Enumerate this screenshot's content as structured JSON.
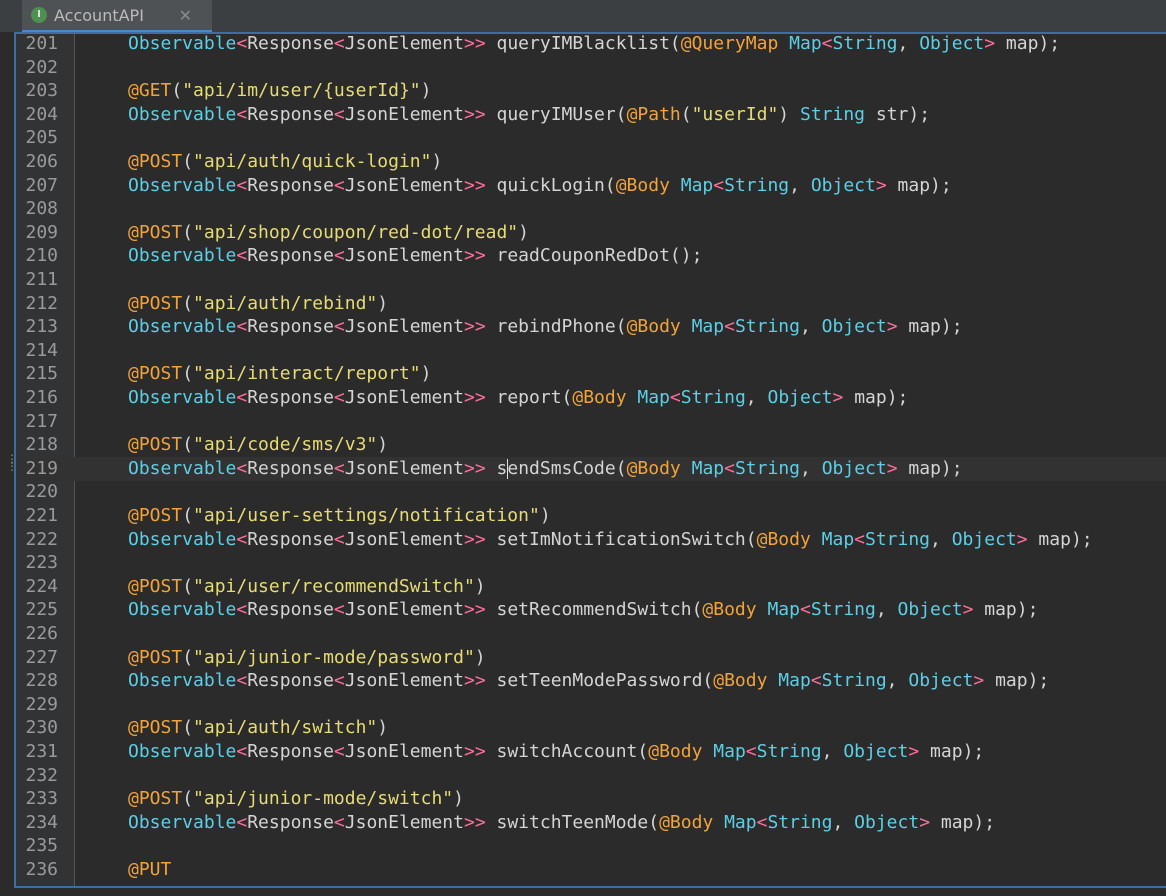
{
  "tab": {
    "title": "AccountAPI",
    "icon": "interface-icon",
    "icon_letter": "I",
    "close": "✕"
  },
  "colors": {
    "background": "#2b2b2b",
    "type": "#5ccfe6",
    "annotation": "#f2a33a",
    "string": "#e6db74",
    "generic_bracket": "#ff6e9b",
    "text": "#d4d4d4",
    "line_number": "#9a9a9a"
  },
  "current_line": 219,
  "lines": [
    {
      "num": 201,
      "tokens": [
        [
          "type",
          "Observable"
        ],
        [
          "angle",
          "<"
        ],
        [
          "plain",
          "Response"
        ],
        [
          "angle",
          "<"
        ],
        [
          "plain",
          "JsonElement"
        ],
        [
          "angle",
          ">>"
        ],
        [
          "plain",
          " queryIMBlacklist("
        ],
        [
          "ann",
          "@QueryMap"
        ],
        [
          "plain",
          " "
        ],
        [
          "type",
          "Map"
        ],
        [
          "angle",
          "<"
        ],
        [
          "type",
          "String"
        ],
        [
          "plain",
          ", "
        ],
        [
          "type",
          "Object"
        ],
        [
          "angle",
          ">"
        ],
        [
          "plain",
          " map);"
        ]
      ]
    },
    {
      "num": 202,
      "tokens": []
    },
    {
      "num": 203,
      "tokens": [
        [
          "ann",
          "@GET"
        ],
        [
          "plain",
          "("
        ],
        [
          "str",
          "\"api/im/user/{userId}\""
        ],
        [
          "plain",
          ")"
        ]
      ]
    },
    {
      "num": 204,
      "tokens": [
        [
          "type",
          "Observable"
        ],
        [
          "angle",
          "<"
        ],
        [
          "plain",
          "Response"
        ],
        [
          "angle",
          "<"
        ],
        [
          "plain",
          "JsonElement"
        ],
        [
          "angle",
          ">>"
        ],
        [
          "plain",
          " queryIMUser("
        ],
        [
          "ann",
          "@Path"
        ],
        [
          "plain",
          "("
        ],
        [
          "str",
          "\"userId\""
        ],
        [
          "plain",
          ") "
        ],
        [
          "type",
          "String"
        ],
        [
          "plain",
          " str);"
        ]
      ]
    },
    {
      "num": 205,
      "tokens": []
    },
    {
      "num": 206,
      "tokens": [
        [
          "ann",
          "@POST"
        ],
        [
          "plain",
          "("
        ],
        [
          "str",
          "\"api/auth/quick-login\""
        ],
        [
          "plain",
          ")"
        ]
      ]
    },
    {
      "num": 207,
      "tokens": [
        [
          "type",
          "Observable"
        ],
        [
          "angle",
          "<"
        ],
        [
          "plain",
          "Response"
        ],
        [
          "angle",
          "<"
        ],
        [
          "plain",
          "JsonElement"
        ],
        [
          "angle",
          ">>"
        ],
        [
          "plain",
          " quickLogin("
        ],
        [
          "ann",
          "@Body"
        ],
        [
          "plain",
          " "
        ],
        [
          "type",
          "Map"
        ],
        [
          "angle",
          "<"
        ],
        [
          "type",
          "String"
        ],
        [
          "plain",
          ", "
        ],
        [
          "type",
          "Object"
        ],
        [
          "angle",
          ">"
        ],
        [
          "plain",
          " map);"
        ]
      ]
    },
    {
      "num": 208,
      "tokens": []
    },
    {
      "num": 209,
      "tokens": [
        [
          "ann",
          "@POST"
        ],
        [
          "plain",
          "("
        ],
        [
          "str",
          "\"api/shop/coupon/red-dot/read\""
        ],
        [
          "plain",
          ")"
        ]
      ]
    },
    {
      "num": 210,
      "tokens": [
        [
          "type",
          "Observable"
        ],
        [
          "angle",
          "<"
        ],
        [
          "plain",
          "Response"
        ],
        [
          "angle",
          "<"
        ],
        [
          "plain",
          "JsonElement"
        ],
        [
          "angle",
          ">>"
        ],
        [
          "plain",
          " readCouponRedDot();"
        ]
      ]
    },
    {
      "num": 211,
      "tokens": []
    },
    {
      "num": 212,
      "tokens": [
        [
          "ann",
          "@POST"
        ],
        [
          "plain",
          "("
        ],
        [
          "str",
          "\"api/auth/rebind\""
        ],
        [
          "plain",
          ")"
        ]
      ]
    },
    {
      "num": 213,
      "tokens": [
        [
          "type",
          "Observable"
        ],
        [
          "angle",
          "<"
        ],
        [
          "plain",
          "Response"
        ],
        [
          "angle",
          "<"
        ],
        [
          "plain",
          "JsonElement"
        ],
        [
          "angle",
          ">>"
        ],
        [
          "plain",
          " rebindPhone("
        ],
        [
          "ann",
          "@Body"
        ],
        [
          "plain",
          " "
        ],
        [
          "type",
          "Map"
        ],
        [
          "angle",
          "<"
        ],
        [
          "type",
          "String"
        ],
        [
          "plain",
          ", "
        ],
        [
          "type",
          "Object"
        ],
        [
          "angle",
          ">"
        ],
        [
          "plain",
          " map);"
        ]
      ]
    },
    {
      "num": 214,
      "tokens": []
    },
    {
      "num": 215,
      "tokens": [
        [
          "ann",
          "@POST"
        ],
        [
          "plain",
          "("
        ],
        [
          "str",
          "\"api/interact/report\""
        ],
        [
          "plain",
          ")"
        ]
      ]
    },
    {
      "num": 216,
      "tokens": [
        [
          "type",
          "Observable"
        ],
        [
          "angle",
          "<"
        ],
        [
          "plain",
          "Response"
        ],
        [
          "angle",
          "<"
        ],
        [
          "plain",
          "JsonElement"
        ],
        [
          "angle",
          ">>"
        ],
        [
          "plain",
          " report("
        ],
        [
          "ann",
          "@Body"
        ],
        [
          "plain",
          " "
        ],
        [
          "type",
          "Map"
        ],
        [
          "angle",
          "<"
        ],
        [
          "type",
          "String"
        ],
        [
          "plain",
          ", "
        ],
        [
          "type",
          "Object"
        ],
        [
          "angle",
          ">"
        ],
        [
          "plain",
          " map);"
        ]
      ]
    },
    {
      "num": 217,
      "tokens": []
    },
    {
      "num": 218,
      "tokens": [
        [
          "ann",
          "@POST"
        ],
        [
          "plain",
          "("
        ],
        [
          "str",
          "\"api/code/sms/v3\""
        ],
        [
          "plain",
          ")"
        ]
      ]
    },
    {
      "num": 219,
      "tokens": [
        [
          "type",
          "Observable"
        ],
        [
          "angle",
          "<"
        ],
        [
          "plain",
          "Response"
        ],
        [
          "angle",
          "<"
        ],
        [
          "plain",
          "JsonElement"
        ],
        [
          "angle",
          ">>"
        ],
        [
          "plain",
          " s"
        ],
        [
          "caret",
          ""
        ],
        [
          "plain",
          "endSmsCode("
        ],
        [
          "ann",
          "@Body"
        ],
        [
          "plain",
          " "
        ],
        [
          "type",
          "Map"
        ],
        [
          "angle",
          "<"
        ],
        [
          "type",
          "String"
        ],
        [
          "plain",
          ", "
        ],
        [
          "type",
          "Object"
        ],
        [
          "angle",
          ">"
        ],
        [
          "plain",
          " map);"
        ]
      ]
    },
    {
      "num": 220,
      "tokens": []
    },
    {
      "num": 221,
      "tokens": [
        [
          "ann",
          "@POST"
        ],
        [
          "plain",
          "("
        ],
        [
          "str",
          "\"api/user-settings/notification\""
        ],
        [
          "plain",
          ")"
        ]
      ]
    },
    {
      "num": 222,
      "tokens": [
        [
          "type",
          "Observable"
        ],
        [
          "angle",
          "<"
        ],
        [
          "plain",
          "Response"
        ],
        [
          "angle",
          "<"
        ],
        [
          "plain",
          "JsonElement"
        ],
        [
          "angle",
          ">>"
        ],
        [
          "plain",
          " setImNotificationSwitch("
        ],
        [
          "ann",
          "@Body"
        ],
        [
          "plain",
          " "
        ],
        [
          "type",
          "Map"
        ],
        [
          "angle",
          "<"
        ],
        [
          "type",
          "String"
        ],
        [
          "plain",
          ", "
        ],
        [
          "type",
          "Object"
        ],
        [
          "angle",
          ">"
        ],
        [
          "plain",
          " map);"
        ]
      ]
    },
    {
      "num": 223,
      "tokens": []
    },
    {
      "num": 224,
      "tokens": [
        [
          "ann",
          "@POST"
        ],
        [
          "plain",
          "("
        ],
        [
          "str",
          "\"api/user/recommendSwitch\""
        ],
        [
          "plain",
          ")"
        ]
      ]
    },
    {
      "num": 225,
      "tokens": [
        [
          "type",
          "Observable"
        ],
        [
          "angle",
          "<"
        ],
        [
          "plain",
          "Response"
        ],
        [
          "angle",
          "<"
        ],
        [
          "plain",
          "JsonElement"
        ],
        [
          "angle",
          ">>"
        ],
        [
          "plain",
          " setRecommendSwitch("
        ],
        [
          "ann",
          "@Body"
        ],
        [
          "plain",
          " "
        ],
        [
          "type",
          "Map"
        ],
        [
          "angle",
          "<"
        ],
        [
          "type",
          "String"
        ],
        [
          "plain",
          ", "
        ],
        [
          "type",
          "Object"
        ],
        [
          "angle",
          ">"
        ],
        [
          "plain",
          " map);"
        ]
      ]
    },
    {
      "num": 226,
      "tokens": []
    },
    {
      "num": 227,
      "tokens": [
        [
          "ann",
          "@POST"
        ],
        [
          "plain",
          "("
        ],
        [
          "str",
          "\"api/junior-mode/password\""
        ],
        [
          "plain",
          ")"
        ]
      ]
    },
    {
      "num": 228,
      "tokens": [
        [
          "type",
          "Observable"
        ],
        [
          "angle",
          "<"
        ],
        [
          "plain",
          "Response"
        ],
        [
          "angle",
          "<"
        ],
        [
          "plain",
          "JsonElement"
        ],
        [
          "angle",
          ">>"
        ],
        [
          "plain",
          " setTeenModePassword("
        ],
        [
          "ann",
          "@Body"
        ],
        [
          "plain",
          " "
        ],
        [
          "type",
          "Map"
        ],
        [
          "angle",
          "<"
        ],
        [
          "type",
          "String"
        ],
        [
          "plain",
          ", "
        ],
        [
          "type",
          "Object"
        ],
        [
          "angle",
          ">"
        ],
        [
          "plain",
          " map);"
        ]
      ]
    },
    {
      "num": 229,
      "tokens": []
    },
    {
      "num": 230,
      "tokens": [
        [
          "ann",
          "@POST"
        ],
        [
          "plain",
          "("
        ],
        [
          "str",
          "\"api/auth/switch\""
        ],
        [
          "plain",
          ")"
        ]
      ]
    },
    {
      "num": 231,
      "tokens": [
        [
          "type",
          "Observable"
        ],
        [
          "angle",
          "<"
        ],
        [
          "plain",
          "Response"
        ],
        [
          "angle",
          "<"
        ],
        [
          "plain",
          "JsonElement"
        ],
        [
          "angle",
          ">>"
        ],
        [
          "plain",
          " switchAccount("
        ],
        [
          "ann",
          "@Body"
        ],
        [
          "plain",
          " "
        ],
        [
          "type",
          "Map"
        ],
        [
          "angle",
          "<"
        ],
        [
          "type",
          "String"
        ],
        [
          "plain",
          ", "
        ],
        [
          "type",
          "Object"
        ],
        [
          "angle",
          ">"
        ],
        [
          "plain",
          " map);"
        ]
      ]
    },
    {
      "num": 232,
      "tokens": []
    },
    {
      "num": 233,
      "tokens": [
        [
          "ann",
          "@POST"
        ],
        [
          "plain",
          "("
        ],
        [
          "str",
          "\"api/junior-mode/switch\""
        ],
        [
          "plain",
          ")"
        ]
      ]
    },
    {
      "num": 234,
      "tokens": [
        [
          "type",
          "Observable"
        ],
        [
          "angle",
          "<"
        ],
        [
          "plain",
          "Response"
        ],
        [
          "angle",
          "<"
        ],
        [
          "plain",
          "JsonElement"
        ],
        [
          "angle",
          ">>"
        ],
        [
          "plain",
          " switchTeenMode("
        ],
        [
          "ann",
          "@Body"
        ],
        [
          "plain",
          " "
        ],
        [
          "type",
          "Map"
        ],
        [
          "angle",
          "<"
        ],
        [
          "type",
          "String"
        ],
        [
          "plain",
          ", "
        ],
        [
          "type",
          "Object"
        ],
        [
          "angle",
          ">"
        ],
        [
          "plain",
          " map);"
        ]
      ]
    },
    {
      "num": 235,
      "tokens": []
    },
    {
      "num": 236,
      "tokens": [
        [
          "ann",
          "@PUT"
        ]
      ]
    }
  ]
}
